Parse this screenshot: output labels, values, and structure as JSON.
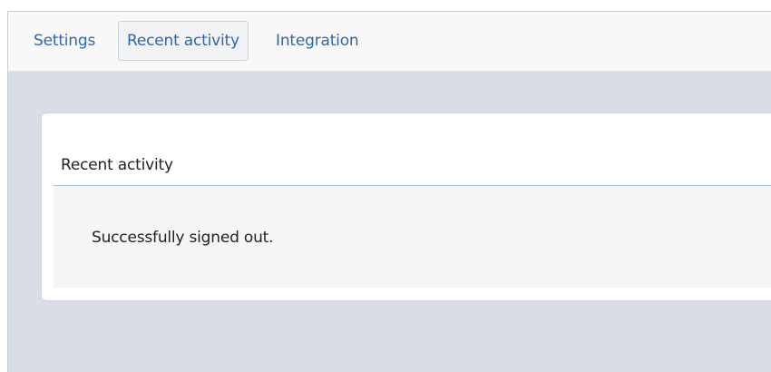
{
  "tabs": [
    {
      "label": "Settings",
      "active": false
    },
    {
      "label": "Recent activity",
      "active": true
    },
    {
      "label": "Integration",
      "active": false
    }
  ],
  "panel": {
    "title": "Recent activity",
    "message": "Successfully signed out."
  },
  "colors": {
    "link": "#2f66ad",
    "background": "#d9dde6",
    "divider": "#a9c1df"
  }
}
